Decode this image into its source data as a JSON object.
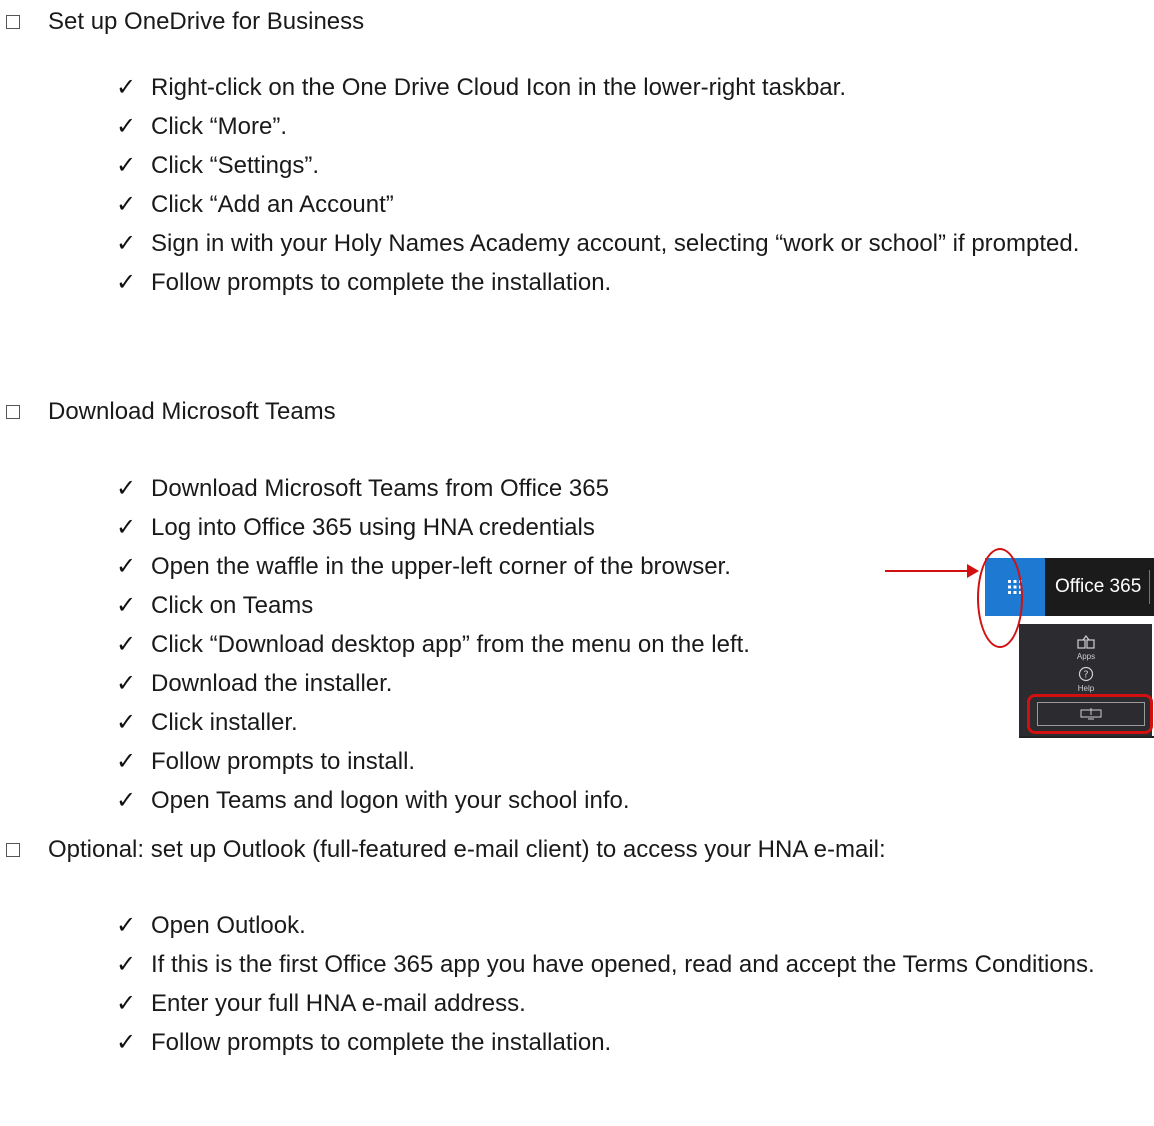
{
  "sections": [
    {
      "heading": "Set up OneDrive for Business",
      "items": [
        "Right-click on the One Drive Cloud Icon in the lower-right taskbar.",
        "Click “More”.",
        "Click “Settings”.",
        "Click “Add an Account”",
        "Sign in with your Holy Names Academy account, selecting “work or school” if prompted.",
        "Follow prompts to complete the installation."
      ]
    },
    {
      "heading": "Download Microsoft Teams",
      "items": [
        "Download Microsoft Teams from Office 365",
        "Log into Office 365 using HNA credentials",
        "Open the waffle in the upper-left corner of the browser.",
        "Click on Teams",
        "Click “Download desktop app” from the menu on the left.",
        "Download the installer.",
        "Click installer.",
        "Follow prompts to install.",
        "Open Teams and logon with your school info."
      ]
    },
    {
      "heading": "Optional: set up Outlook (full-featured e-mail client) to access your HNA e-mail:",
      "items": [
        "Open Outlook.",
        "If this is the first Office 365 app you have opened, read and accept the Terms Conditions.",
        "Enter your full HNA e-mail address.",
        "Follow prompts to complete the installation."
      ]
    }
  ],
  "illustration": {
    "app_title": "Office 365",
    "apps_label": "Apps",
    "help_label": "Help",
    "waffle_icon": "waffle-icon",
    "accent": "#1e79d2",
    "annotation_color": "#d21010"
  }
}
